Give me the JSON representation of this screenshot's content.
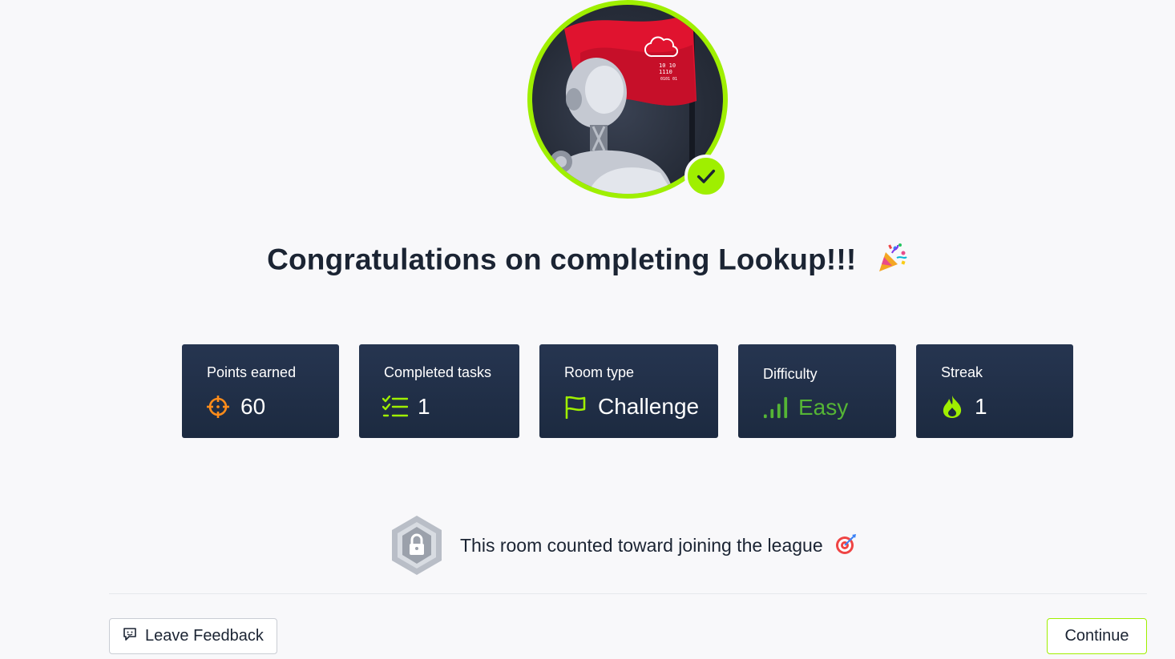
{
  "header": {
    "title": "Congratulations on completing Lookup!!!"
  },
  "stats": [
    {
      "label": "Points earned",
      "value": "60",
      "icon": "crosshair-icon"
    },
    {
      "label": "Completed tasks",
      "value": "1",
      "icon": "task-list-icon"
    },
    {
      "label": "Room type",
      "value": "Challenge",
      "icon": "flag-icon"
    },
    {
      "label": "Difficulty",
      "value": "Easy",
      "icon": "signal-bars-icon"
    },
    {
      "label": "Streak",
      "value": "1",
      "icon": "flame-icon"
    }
  ],
  "league": {
    "text": "This room counted toward joining the league"
  },
  "footer": {
    "feedback_label": "Leave Feedback",
    "continue_label": "Continue"
  },
  "colors": {
    "accent": "#9fef00",
    "card_bg": "#1c2a40",
    "easy_green": "#55b535",
    "points_orange": "#ff8c1a"
  }
}
